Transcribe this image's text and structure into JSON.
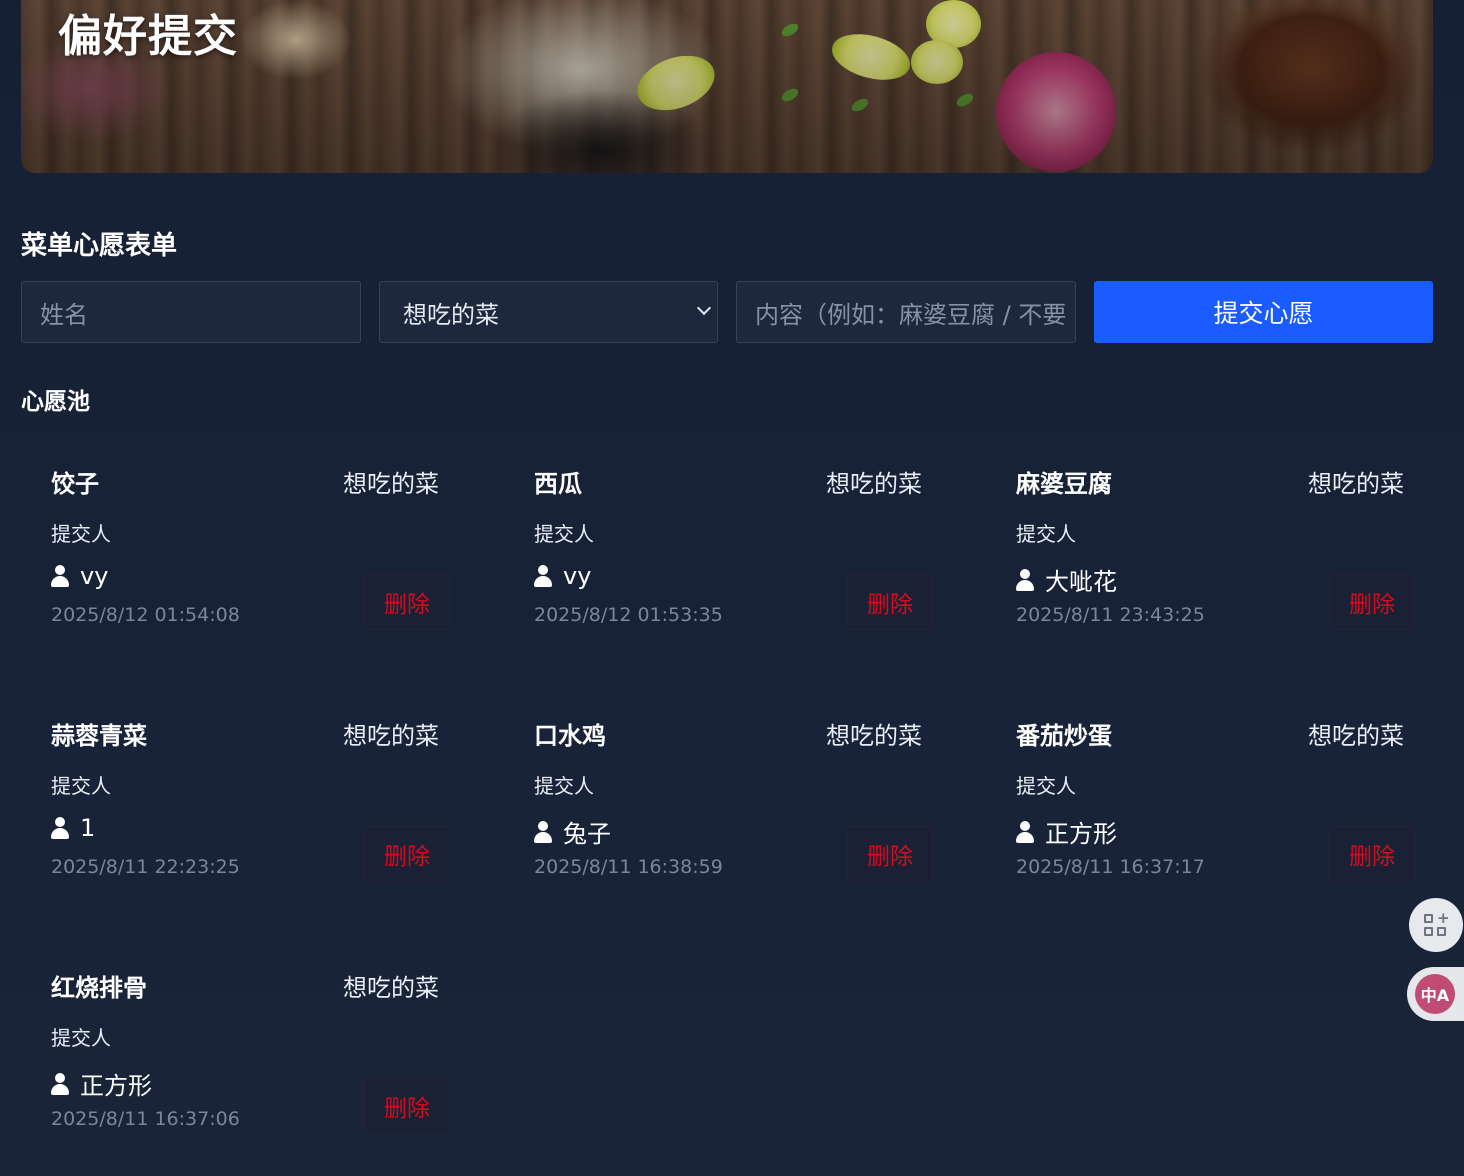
{
  "banner": {
    "title": "偏好提交"
  },
  "form": {
    "title": "菜单心愿表单",
    "name_placeholder": "姓名",
    "type_selected": "想吃的菜",
    "content_placeholder": "内容（例如：麻婆豆腐 / 不要",
    "submit_label": "提交心愿"
  },
  "pool": {
    "title": "心愿池",
    "submitter_label": "提交人",
    "delete_label": "删除",
    "items": [
      {
        "dish": "饺子",
        "type": "想吃的菜",
        "submitter": "vy",
        "time": "2025/8/12 01:54:08"
      },
      {
        "dish": "西瓜",
        "type": "想吃的菜",
        "submitter": "vy",
        "time": "2025/8/12 01:53:35"
      },
      {
        "dish": "麻婆豆腐",
        "type": "想吃的菜",
        "submitter": "大呲花",
        "time": "2025/8/11 23:43:25"
      },
      {
        "dish": "蒜蓉青菜",
        "type": "想吃的菜",
        "submitter": "1",
        "time": "2025/8/11 22:23:25"
      },
      {
        "dish": "口水鸡",
        "type": "想吃的菜",
        "submitter": "兔子",
        "time": "2025/8/11 16:38:59"
      },
      {
        "dish": "番茄炒蛋",
        "type": "想吃的菜",
        "submitter": "正方形",
        "time": "2025/8/11 16:37:17"
      },
      {
        "dish": "红烧排骨",
        "type": "想吃的菜",
        "submitter": "正方形",
        "time": "2025/8/11 16:37:06"
      }
    ]
  },
  "widgets": {
    "translate_glyph": "中A",
    "apps_icon": "apps-add-icon"
  },
  "colors": {
    "accent": "#1a5cff",
    "delete": "#d80a1e",
    "background": "#18223a"
  }
}
